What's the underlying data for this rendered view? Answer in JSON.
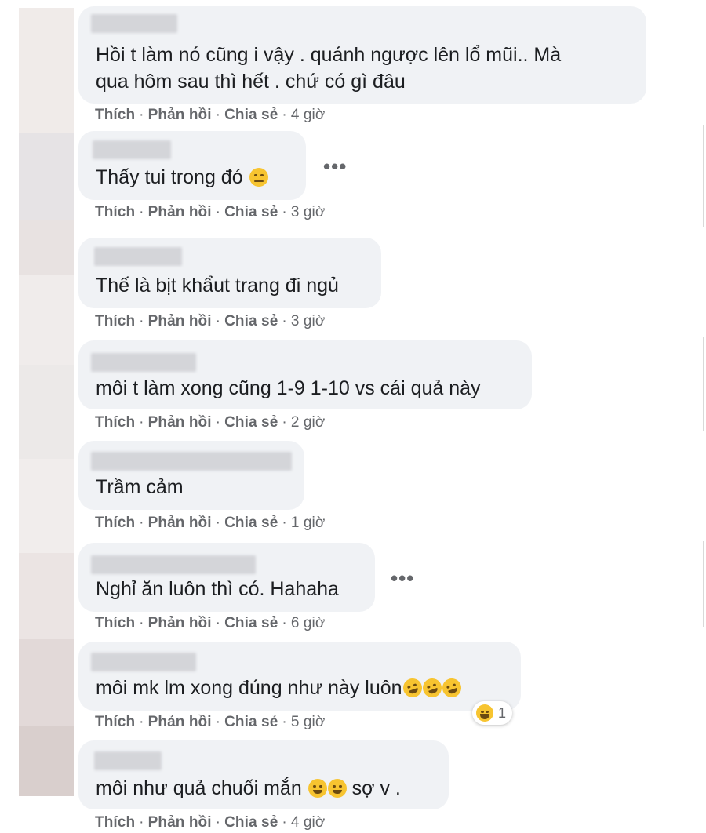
{
  "actions": {
    "like": "Thích",
    "reply": "Phản hồi",
    "share": "Chia sẻ",
    "sep": "·"
  },
  "comments": [
    {
      "line1": "Hồi t làm nó cũng i vậy . quánh ngược lên lổ mũi.. Mà",
      "line2": "qua hôm sau thì hết . chứ có gì đâu",
      "time": "4 giờ"
    },
    {
      "text": "Thấy tui trong đó",
      "time": "3 giờ",
      "emoji": "relieved-face-icon"
    },
    {
      "text": "Thế là bịt khẩut trang đi ngủ",
      "time": "3 giờ"
    },
    {
      "text": "môi t làm xong cũng 1-9 1-10 vs cái quả này",
      "time": "2 giờ"
    },
    {
      "text": "Trầm cảm",
      "time": "1 giờ"
    },
    {
      "text": "Nghỉ ăn luôn thì có. Hahaha",
      "time": "6 giờ"
    },
    {
      "text": "môi mk lm xong đúng như này luôn",
      "time": "5 giờ",
      "emoji": "rolling-on-floor-laughing-icon",
      "reaction_count": "1"
    },
    {
      "text": "môi như quả chuối mắn",
      "text_after": "sợ v .",
      "time": "4 giờ",
      "emoji": "grinning-sweat-face-icon"
    }
  ],
  "more_label": "•••"
}
